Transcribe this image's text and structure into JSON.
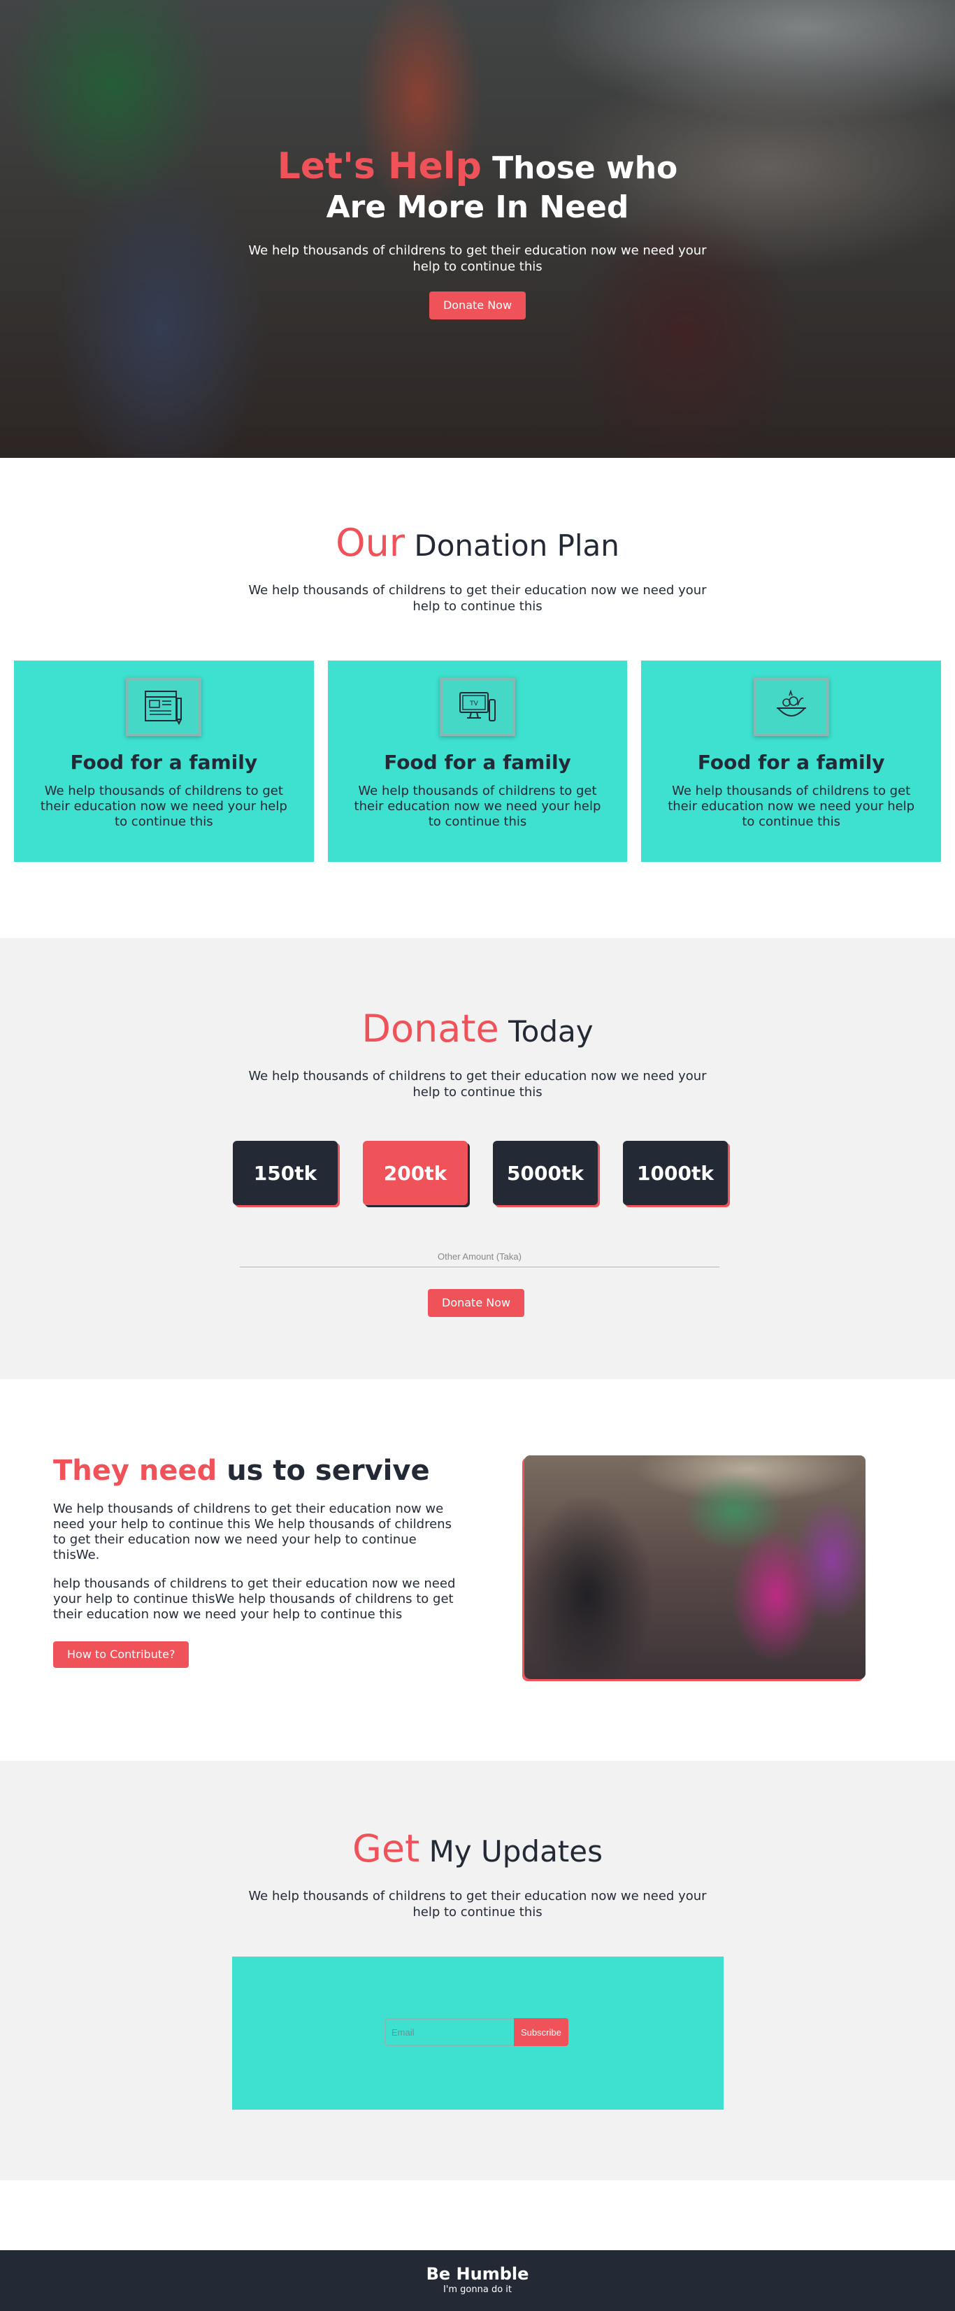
{
  "hero": {
    "title_accent": "Let's Help",
    "title_rest": " Those who Are More In Need",
    "subtitle": "We help thousands of childrens to get their education now we need your help to continue this",
    "button": "Donate Now"
  },
  "plan": {
    "title_accent": "Our",
    "title_rest": " Donation Plan",
    "subtitle": "We help thousands of childrens to get their education now we need your help to continue this",
    "cards": [
      {
        "icon": "newspaper-icon",
        "title": "Food for a family",
        "text": "We help thousands of childrens to get their education now we need your help to continue this"
      },
      {
        "icon": "tv-icon",
        "title": "Food for a family",
        "text": "We help thousands of childrens to get their education now we need your help to continue this"
      },
      {
        "icon": "food-bowl-icon",
        "title": "Food for a family",
        "text": "We help thousands of childrens to get their education now we need your help to continue this"
      }
    ]
  },
  "donate": {
    "title_accent": "Donate",
    "title_rest": " Today",
    "subtitle": "We help thousands of childrens to get their education now we need your help to continue this",
    "amounts": [
      "150tk",
      "200tk",
      "5000tk",
      "1000tk"
    ],
    "selected_amount": "200tk",
    "other_placeholder": "Other Amount (Taka)",
    "button": "Donate Now"
  },
  "need": {
    "title_accent": "They need",
    "title_rest": " us to servive",
    "p1": "We help thousands of childrens to get their education now we need your help to continue this We help thousands of childrens to get their education now we need your help to continue thisWe.",
    "p2": "help thousands of childrens to get their education now we need your help to continue thisWe help thousands of childrens to get their education now we need your help to continue this",
    "button": "How to Contribute?"
  },
  "updates": {
    "title_accent": "Get",
    "title_rest": " My Updates",
    "subtitle": "We help thousands of childrens to get their education now we need your help to continue this",
    "email_placeholder": "Email",
    "button": "Subscribe"
  },
  "footer": {
    "title": "Be Humble",
    "subtitle": "I'm gonna do it"
  },
  "colors": {
    "accent": "#f0525a",
    "teal": "#3ee0d0",
    "dark": "#232a36",
    "light_bg": "#f2f2f2"
  }
}
